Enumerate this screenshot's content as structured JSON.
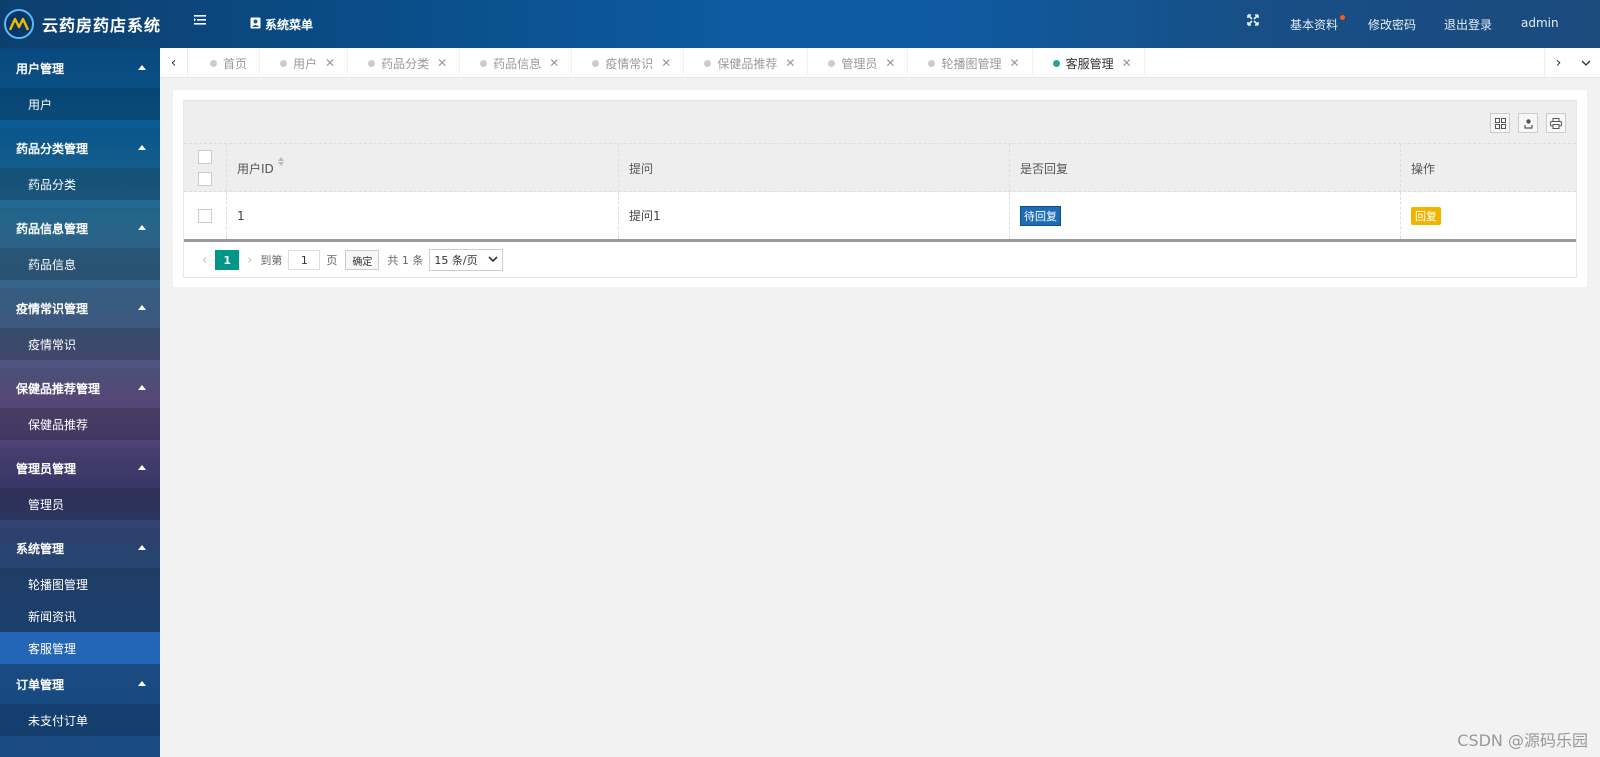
{
  "header": {
    "app_title": "云药房药店系统",
    "system_menu_label": "系统菜单",
    "right_items": [
      "基本资料",
      "修改密码",
      "退出登录",
      "admin"
    ],
    "accent_color": "#0d5aa0"
  },
  "sidebar": {
    "groups": [
      {
        "label": "用户管理",
        "items": [
          "用户"
        ]
      },
      {
        "label": "药品分类管理",
        "items": [
          "药品分类"
        ]
      },
      {
        "label": "药品信息管理",
        "items": [
          "药品信息"
        ]
      },
      {
        "label": "疫情常识管理",
        "items": [
          "疫情常识"
        ]
      },
      {
        "label": "保健品推荐管理",
        "items": [
          "保健品推荐"
        ]
      },
      {
        "label": "管理员管理",
        "items": [
          "管理员"
        ]
      },
      {
        "label": "系统管理",
        "items": [
          "轮播图管理",
          "新闻资讯",
          "客服管理"
        ]
      },
      {
        "label": "订单管理",
        "items": [
          "未支付订单"
        ]
      }
    ],
    "active_item": "客服管理"
  },
  "tabs": [
    {
      "label": "首页"
    },
    {
      "label": "用户"
    },
    {
      "label": "药品分类"
    },
    {
      "label": "药品信息"
    },
    {
      "label": "疫情常识"
    },
    {
      "label": "保健品推荐"
    },
    {
      "label": "管理员"
    },
    {
      "label": "轮播图管理"
    },
    {
      "label": "客服管理"
    }
  ],
  "table": {
    "columns": [
      "用户ID",
      "提问",
      "是否回复",
      "操作"
    ],
    "rows": [
      {
        "user_id": "1",
        "question": "提问1",
        "reply_status": "待回复",
        "action": "回复"
      }
    ]
  },
  "pager": {
    "current_page": "1",
    "goto_label": "到第",
    "goto_value": "1",
    "page_unit": "页",
    "confirm_label": "确定",
    "total_label": "共 1 条",
    "page_size_label": "15 条/页"
  },
  "watermark": "CSDN @源码乐园"
}
